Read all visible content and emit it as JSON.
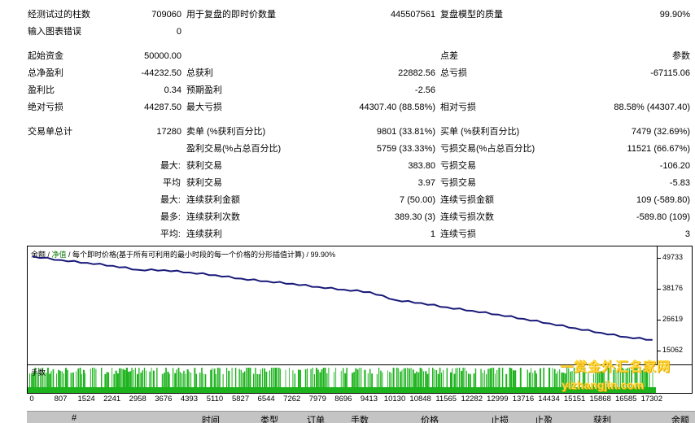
{
  "report": {
    "bars_tested_label": "经测试过的柱数",
    "bars_tested": "709060",
    "ticks_label": "用于复盘的即时价数量",
    "ticks": "445507561",
    "quality_label": "复盘模型的质量",
    "quality": "99.90%",
    "chart_errors_label": "输入图表错误",
    "chart_errors": "0",
    "initial_deposit_label": "起始资金",
    "initial_deposit": "50000.00",
    "spread_label": "点差",
    "spread": "参数",
    "net_profit_label": "总净盈利",
    "net_profit": "-44232.50",
    "gross_profit_label": "总获利",
    "gross_profit": "22882.56",
    "gross_loss_label": "总亏损",
    "gross_loss": "-67115.06",
    "profit_factor_label": "盈利比",
    "profit_factor": "0.34",
    "expected_payoff_label": "预期盈利",
    "expected_payoff": "-2.56",
    "abs_drawdown_label": "绝对亏损",
    "abs_drawdown": "44287.50",
    "max_drawdown_label": "最大亏损",
    "max_drawdown": "44307.40 (88.58%)",
    "rel_drawdown_label": "相对亏损",
    "rel_drawdown": "88.58% (44307.40)",
    "total_trades_label": "交易单总计",
    "total_trades": "17280",
    "short_label": "卖单 (%获利百分比)",
    "short": "9801 (33.81%)",
    "long_label": "买单 (%获利百分比)",
    "long": "7479 (32.69%)",
    "profit_trades_label": "盈利交易(%占总百分比)",
    "profit_trades": "5759 (33.33%)",
    "loss_trades_label": "亏损交易(%占总百分比)",
    "loss_trades": "11521 (66.67%)",
    "largest_label": "最大:",
    "largest_profit_label": "获利交易",
    "largest_profit": "383.80",
    "largest_loss_label": "亏损交易",
    "largest_loss": "-106.20",
    "average_label": "平均",
    "average_profit_label": "获利交易",
    "average_profit": "3.97",
    "average_loss_label": "亏损交易",
    "average_loss": "-5.83",
    "max_cons_label": "最大:",
    "max_cons_wins_label": "连续获利金额",
    "max_cons_wins": "7 (50.00)",
    "max_cons_losses_label": "连续亏损金额",
    "max_cons_losses": "109 (-589.80)",
    "maximal_label": "最多:",
    "max_cons_profit_label": "连续获利次数",
    "max_cons_profit": "389.30 (3)",
    "max_cons_loss_label": "连续亏损次数",
    "max_cons_loss": "-589.80 (109)",
    "avg_cons_label": "平均:",
    "avg_cons_wins_label": "连续获利",
    "avg_cons_wins": "1",
    "avg_cons_losses_label": "连续亏损",
    "avg_cons_losses": "3"
  },
  "chart": {
    "header_balance": "余额",
    "header_sep1": " / ",
    "header_equity": "净值",
    "header_rest": " / 每个即时价格(基于所有可利用的最小时段的每一个价格的分形插值计算) / 99.90%",
    "volume_label": "手数",
    "colors": {
      "balance_line": "#1a1a7a",
      "volume_bars": "#1db31d",
      "axis": "#000000"
    }
  },
  "chart_data": {
    "type": "line",
    "title": "",
    "series": [
      {
        "name": "余额",
        "x": [
          0,
          807,
          1524,
          2241,
          2958,
          3676,
          4393,
          5110,
          5827,
          6544,
          7262,
          7979,
          8696,
          9413,
          10130,
          10848,
          11565,
          12282,
          12999,
          13716,
          14434,
          15151,
          15868,
          16585,
          17302
        ],
        "y": [
          50300,
          48900,
          47900,
          46800,
          45300,
          45200,
          44300,
          43300,
          42000,
          41000,
          40100,
          38900,
          37900,
          37000,
          34000,
          32900,
          31300,
          30000,
          28600,
          27000,
          25300,
          23500,
          21800,
          20200,
          19200
        ]
      }
    ],
    "yticks": [
      "49733",
      "38176",
      "26619",
      "15062"
    ],
    "xticks": [
      "0",
      "807",
      "1524",
      "2241",
      "2958",
      "3676",
      "4393",
      "5110",
      "5827",
      "6544",
      "7262",
      "7979",
      "8696",
      "9413",
      "10130",
      "10848",
      "11565",
      "12282",
      "12999",
      "13716",
      "14434",
      "15151",
      "15868",
      "16585",
      "17302"
    ],
    "ylim": [
      10000,
      54000
    ],
    "xlim": [
      0,
      17420
    ],
    "grid": false
  },
  "table_header": {
    "index": "#",
    "time": "时间",
    "type": "类型",
    "order": "订单",
    "lots": "手数",
    "price": "价格",
    "sl": "止损",
    "tp": "止盈",
    "profit": "获利",
    "balance": "余额"
  },
  "watermark": {
    "line1": "一赏金外汇名家网",
    "line2": "yizhangjin.com"
  }
}
